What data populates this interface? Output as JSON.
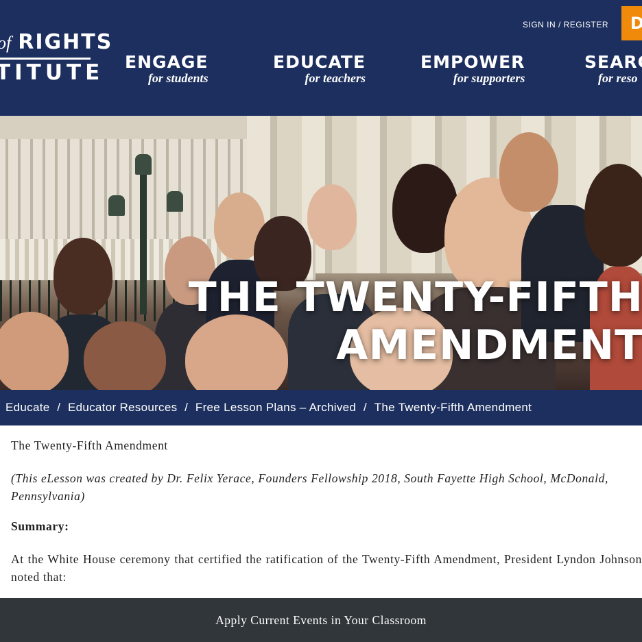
{
  "header": {
    "logo": {
      "line1_prefix": "of",
      "line1": "RIGHTS",
      "line2": "TITUTE"
    },
    "sign_in": "SIGN IN / REGISTER",
    "donate_label": "D",
    "nav": [
      {
        "title": "ENGAGE",
        "subtitle": "for students"
      },
      {
        "title": "EDUCATE",
        "subtitle": "for teachers"
      },
      {
        "title": "EMPOWER",
        "subtitle": "for supporters"
      },
      {
        "title": "SEARC",
        "subtitle": "for reso"
      }
    ]
  },
  "hero": {
    "title_line1": "THE TWENTY-FIFTH",
    "title_line2": "AMENDMENT"
  },
  "breadcrumb": {
    "items": [
      "Educate",
      "Educator Resources",
      "Free Lesson Plans – Archived",
      "The Twenty-Fifth Amendment"
    ],
    "separator": "/"
  },
  "content": {
    "title": "The Twenty-Fifth Amendment",
    "credit": "(This eLesson was created by Dr. Felix Yerace, Founders Fellowship 2018, South Fayette High School, McDonald, Pennsylvania)",
    "summary_heading": "Summary:",
    "body": "At the White House ceremony that certified the ratification of the Twenty-Fifth Amendment, President Lyndon Johnson noted that:"
  },
  "footer": {
    "cta": "Apply Current Events in Your Classroom"
  },
  "colors": {
    "navy": "#1c2f5e",
    "donate_orange": "#f08a0a",
    "footer_gray": "#31363b"
  }
}
